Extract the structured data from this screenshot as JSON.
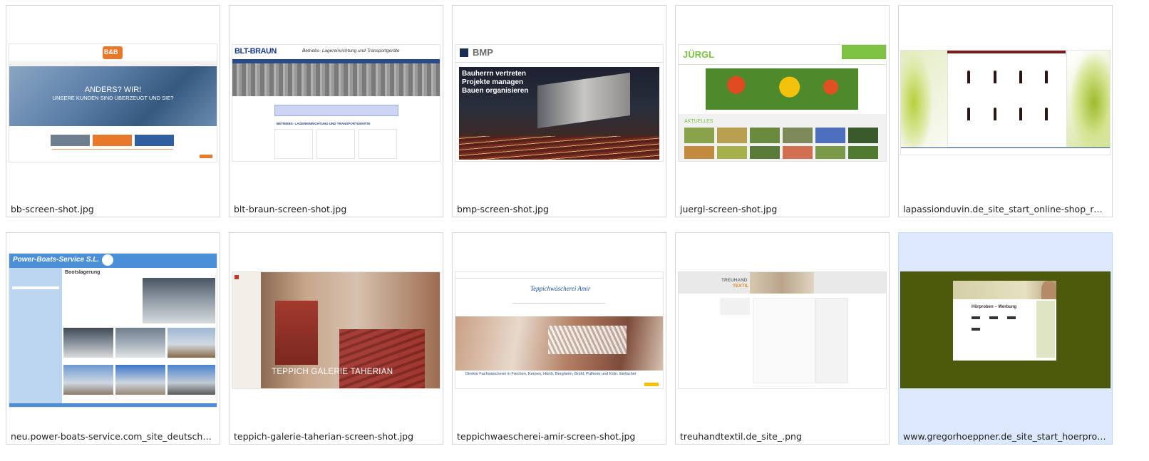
{
  "files": [
    {
      "name": "bb-screen-shot.jpg"
    },
    {
      "name": "blt-braun-screen-shot.jpg"
    },
    {
      "name": "bmp-screen-shot.jpg"
    },
    {
      "name": "juergl-screen-shot.jpg"
    },
    {
      "name": "lapassionduvin.de_site_start_online-shop_rotw..."
    },
    {
      "name": "neu.power-boats-service.com_site_deutsch_ma..."
    },
    {
      "name": "teppich-galerie-taherian-screen-shot.jpg"
    },
    {
      "name": "teppichwaescherei-amir-screen-shot.jpg"
    },
    {
      "name": "treuhandtextil.de_site_.png"
    },
    {
      "name": "www.gregorhoeppner.de_site_start_hoerproben..."
    }
  ],
  "thumbs": {
    "bb": {
      "logo": "B&B",
      "headline": "ANDERS? WIR!",
      "subline": "UNSERE KUNDEN SIND ÜBERZEUGT UND SIE?"
    },
    "blt": {
      "logo": "BLT-BRAUN",
      "tagline": "Betriebs- Lagereinrichtung und Transportgeräte",
      "section": "BETRIEBS- LAGEREINRICHTUNG UND TRANSPORTGERÄTE"
    },
    "bmp": {
      "logo": "BMP",
      "line1": "Bauherrn vertreten",
      "line2": "Projekte managen",
      "line3": "Bauen organisieren"
    },
    "juergl": {
      "logo": "JÜRGL",
      "section": "AKTUELLES"
    },
    "power": {
      "logo": "Power-Boats-Service S.L.",
      "heading": "Bootslagerung"
    },
    "taherian": {
      "title": "TEPPICH GALERIE TAHERIAN"
    },
    "amir": {
      "logo": "Teppichwäscherei Amir",
      "banner": "Direkte Fachwäscherei in Frechen, Kerpen, Hürth, Bergheim, Brühl, Pulheim und Köln. Einfacher"
    },
    "treuhand": {
      "logo1": "TREUHAND",
      "logo2": "TEXTIL"
    },
    "gregor": {
      "heading": "Hörproben – Werbung"
    }
  },
  "colors": {
    "accent_orange": "#e8782a",
    "selected_bg": "#dce8fb",
    "juergl_green": "#7dc242",
    "olive_bg": "#4d5a0c"
  }
}
